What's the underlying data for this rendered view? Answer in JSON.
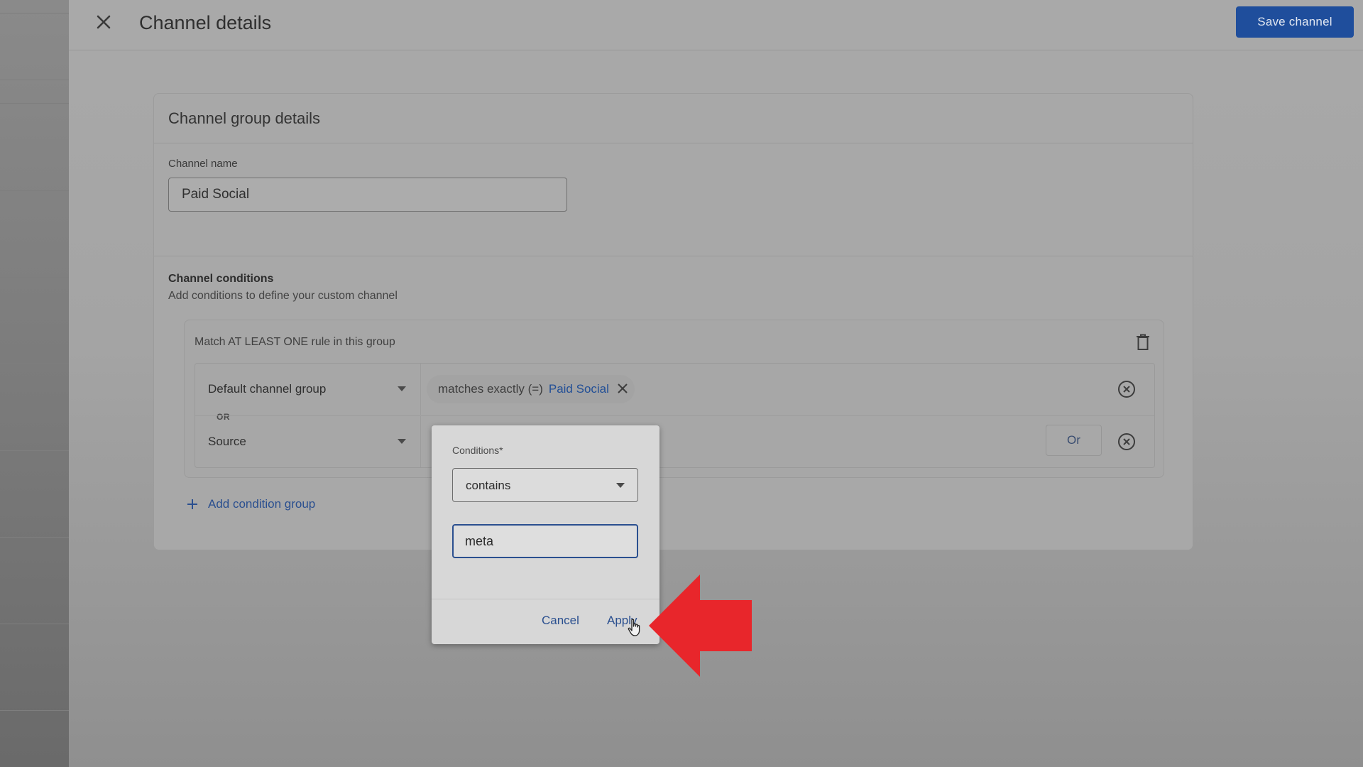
{
  "header": {
    "title": "Channel details",
    "save_label": "Save channel",
    "accent_color": "#1f4e9c"
  },
  "card": {
    "title": "Channel group details",
    "channel_name_label": "Channel name",
    "channel_name_value": "Paid Social",
    "conditions_title": "Channel conditions",
    "conditions_subtitle": "Add conditions to define your custom channel",
    "group": {
      "title": "Match AT LEAST ONE rule in this group",
      "rules": [
        {
          "dimension": "Default channel group",
          "chip_operator": "matches exactly (=)",
          "chip_value": "Paid Social"
        },
        {
          "dimension": "Source",
          "or_button_label": "Or"
        }
      ],
      "or_separator": "OR"
    },
    "add_condition_group_label": "Add condition group"
  },
  "dialog": {
    "label": "Conditions*",
    "selected_condition": "contains",
    "input_value": "meta",
    "cancel_label": "Cancel",
    "apply_label": "Apply"
  },
  "annotation": {
    "arrow_color": "#e8262b"
  }
}
